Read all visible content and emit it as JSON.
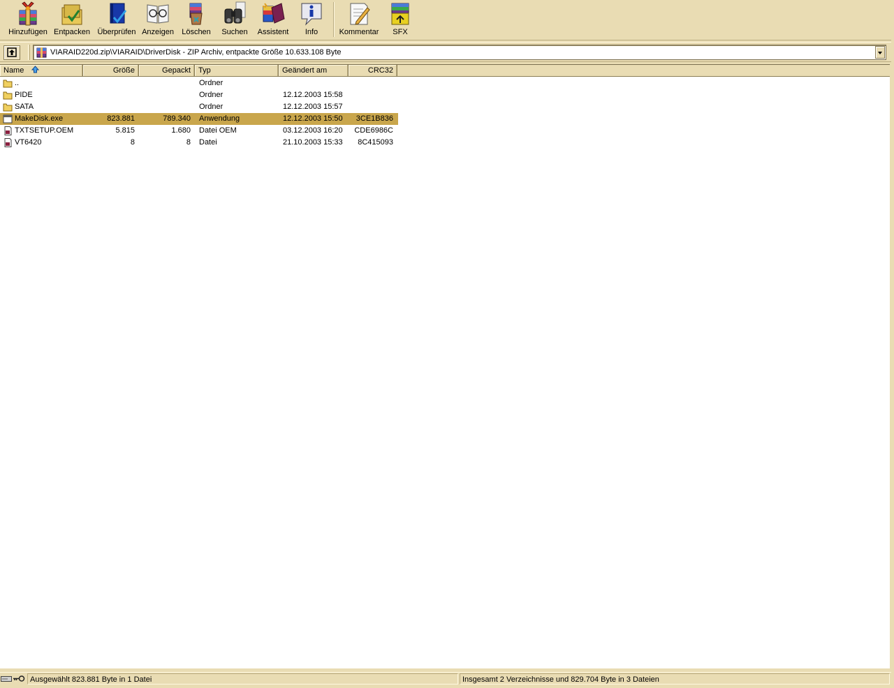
{
  "toolbar": {
    "buttons": [
      {
        "label": "Hinzufügen",
        "icon": "add-archive-icon"
      },
      {
        "label": "Entpacken",
        "icon": "extract-folder-icon"
      },
      {
        "label": "Überprüfen",
        "icon": "test-book-icon"
      },
      {
        "label": "Anzeigen",
        "icon": "view-glasses-icon"
      },
      {
        "label": "Löschen",
        "icon": "delete-bin-icon"
      },
      {
        "label": "Suchen",
        "icon": "find-binoculars-icon"
      },
      {
        "label": "Assistent",
        "icon": "wizard-icon"
      },
      {
        "label": "Info",
        "icon": "info-icon"
      },
      {
        "label": "Kommentar",
        "icon": "comment-icon"
      },
      {
        "label": "SFX",
        "icon": "sfx-icon"
      }
    ]
  },
  "address": {
    "path": "VIARAID220d.zip\\VIARAID\\DriverDisk - ZIP Archiv, entpackte Größe 10.633.108 Byte"
  },
  "columns": {
    "name": "Name",
    "size": "Größe",
    "packed": "Gepackt",
    "type": "Typ",
    "modified": "Geändert am",
    "crc": "CRC32"
  },
  "files": [
    {
      "name": "..",
      "size": "",
      "packed": "",
      "type": "Ordner",
      "modified": "",
      "crc": "",
      "icon": "folder-up-icon"
    },
    {
      "name": "PIDE",
      "size": "",
      "packed": "",
      "type": "Ordner",
      "modified": "12.12.2003 15:58",
      "crc": "",
      "icon": "folder-icon"
    },
    {
      "name": "SATA",
      "size": "",
      "packed": "",
      "type": "Ordner",
      "modified": "12.12.2003 15:57",
      "crc": "",
      "icon": "folder-icon"
    },
    {
      "name": "MakeDisk.exe",
      "size": "823.881",
      "packed": "789.340",
      "type": "Anwendung",
      "modified": "12.12.2003 15:50",
      "crc": "3CE1B836",
      "icon": "application-icon",
      "selected": true
    },
    {
      "name": "TXTSETUP.OEM",
      "size": "5.815",
      "packed": "1.680",
      "type": "Datei OEM",
      "modified": "03.12.2003 16:20",
      "crc": "CDE6986C",
      "icon": "file-icon"
    },
    {
      "name": "VT6420",
      "size": "8",
      "packed": "8",
      "type": "Datei",
      "modified": "21.10.2003 15:33",
      "crc": "8C415093",
      "icon": "file-icon"
    }
  ],
  "status": {
    "selected": "Ausgewählt 823.881 Byte in 1 Datei",
    "total": "Insgesamt 2 Verzeichnisse und 829.704 Byte in 3 Dateien"
  },
  "colors": {
    "background": "#e9dcb3",
    "selection": "#c9a64c"
  }
}
